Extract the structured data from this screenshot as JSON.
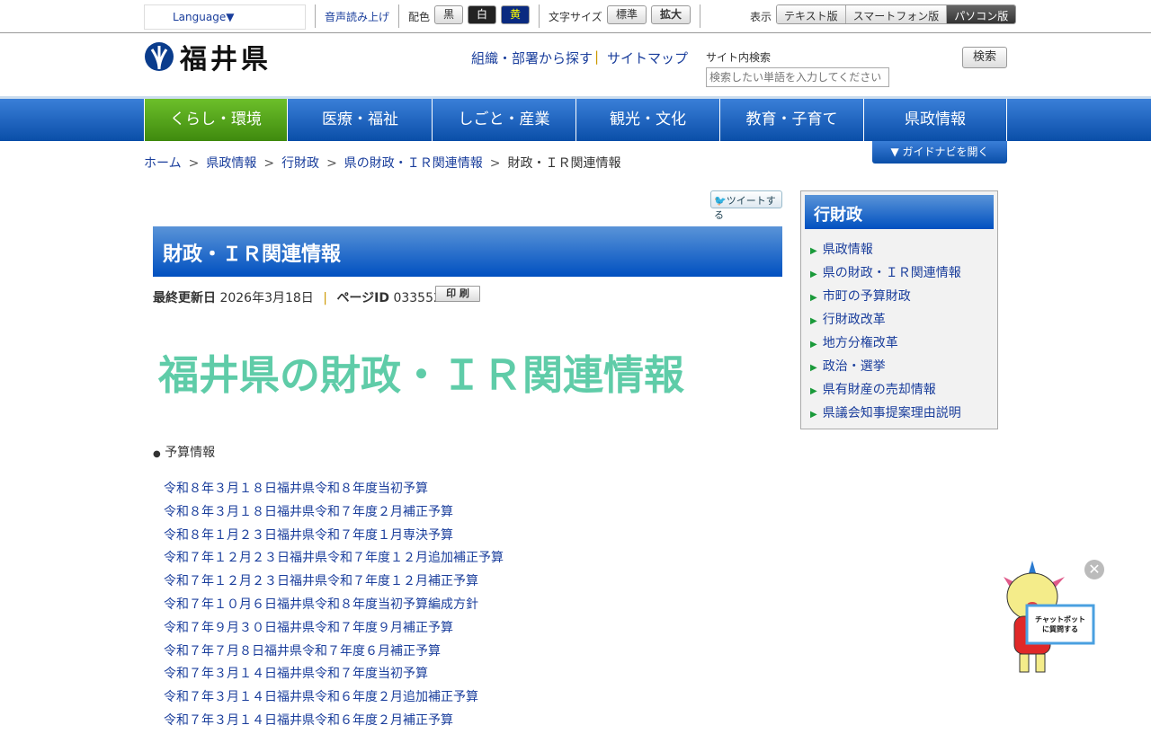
{
  "topbar": {
    "language": "Language▼",
    "read_aloud": "音声読み上げ",
    "color_label": "配色",
    "colors": [
      "黒",
      "白",
      "黄"
    ],
    "font_label": "文字サイズ",
    "font_sizes": [
      "標準",
      "拡大"
    ],
    "view_label": "表示",
    "views": [
      "テキスト版",
      "スマートフォン版",
      "パソコン版"
    ]
  },
  "header": {
    "logo": "福井県",
    "org_link": "組織・部署から探す",
    "sitemap": "サイトマップ",
    "search_label": "サイト内検索",
    "search_placeholder": "検索したい単語を入力してください",
    "search_button": "検索"
  },
  "nav": [
    "くらし・環境",
    "医療・福祉",
    "しごと・産業",
    "観光・文化",
    "教育・子育て",
    "県政情報"
  ],
  "guide": "▼ ガイドナビを開く",
  "breadcrumb": [
    "ホーム",
    "県政情報",
    "行財政",
    "県の財政・ＩＲ関連情報",
    "財政・ＩＲ関連情報"
  ],
  "tweet": "ツイートする",
  "title": "財政・ＩＲ関連情報",
  "meta": {
    "updated_label": "最終更新日",
    "updated": "2026年3月18日",
    "pageid_label": "ページID",
    "pageid": "033552",
    "print": "印 刷"
  },
  "banner": "福井県の財政・ＩＲ関連情報",
  "section": "予算情報",
  "links": [
    "令和８年３月１８日福井県令和８年度当初予算",
    "令和８年３月１８日福井県令和７年度２月補正予算",
    "令和８年１月２３日福井県令和７年度１月専決予算",
    "令和７年１２月２３日福井県令和７年度１２月追加補正予算",
    "令和７年１２月２３日福井県令和７年度１２月補正予算",
    "令和７年１０月６日福井県令和８年度当初予算編成方針",
    "令和７年９月３０日福井県令和７年度９月補正予算",
    "令和７年７月８日福井県令和７年度６月補正予算",
    "令和７年３月１４日福井県令和７年度当初予算",
    "令和７年３月１４日福井県令和６年度２月追加補正予算",
    "令和７年３月１４日福井県令和６年度２月補正予算"
  ],
  "sidebar": {
    "title": "行財政",
    "items": [
      "県政情報",
      "県の財政・ＩＲ関連情報",
      "市町の予算財政",
      "行財政改革",
      "地方分権改革",
      "政治・選挙",
      "県有財産の売却情報",
      "県議会知事提案理由説明"
    ]
  },
  "chatbot": "チャットボットに質問する"
}
